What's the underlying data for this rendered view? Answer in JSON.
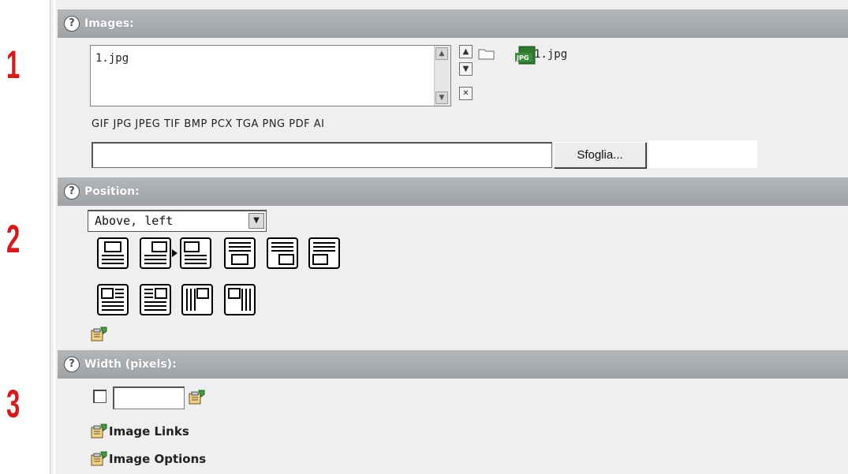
{
  "steps": [
    "1",
    "2",
    "3"
  ],
  "sections": {
    "images": {
      "title": "Images:",
      "files": [
        "1.jpg"
      ],
      "preview_file": "1.jpg",
      "allowed_types": "GIF JPG JPEG TIF BMP PCX TGA PNG PDF AI",
      "browse_label": "Sfoglia..."
    },
    "position": {
      "title": "Position:",
      "selected": "Above, left"
    },
    "width": {
      "title": "Width (pixels):",
      "value": ""
    }
  },
  "links": {
    "image_links": "Image Links",
    "image_options": "Image Options"
  },
  "icons": {
    "help": "?",
    "jpg_badge": "JPG"
  },
  "colors": {
    "step_number": "#d8191c",
    "header_bg": "#a7aaad",
    "panel_bg": "#efefef"
  }
}
